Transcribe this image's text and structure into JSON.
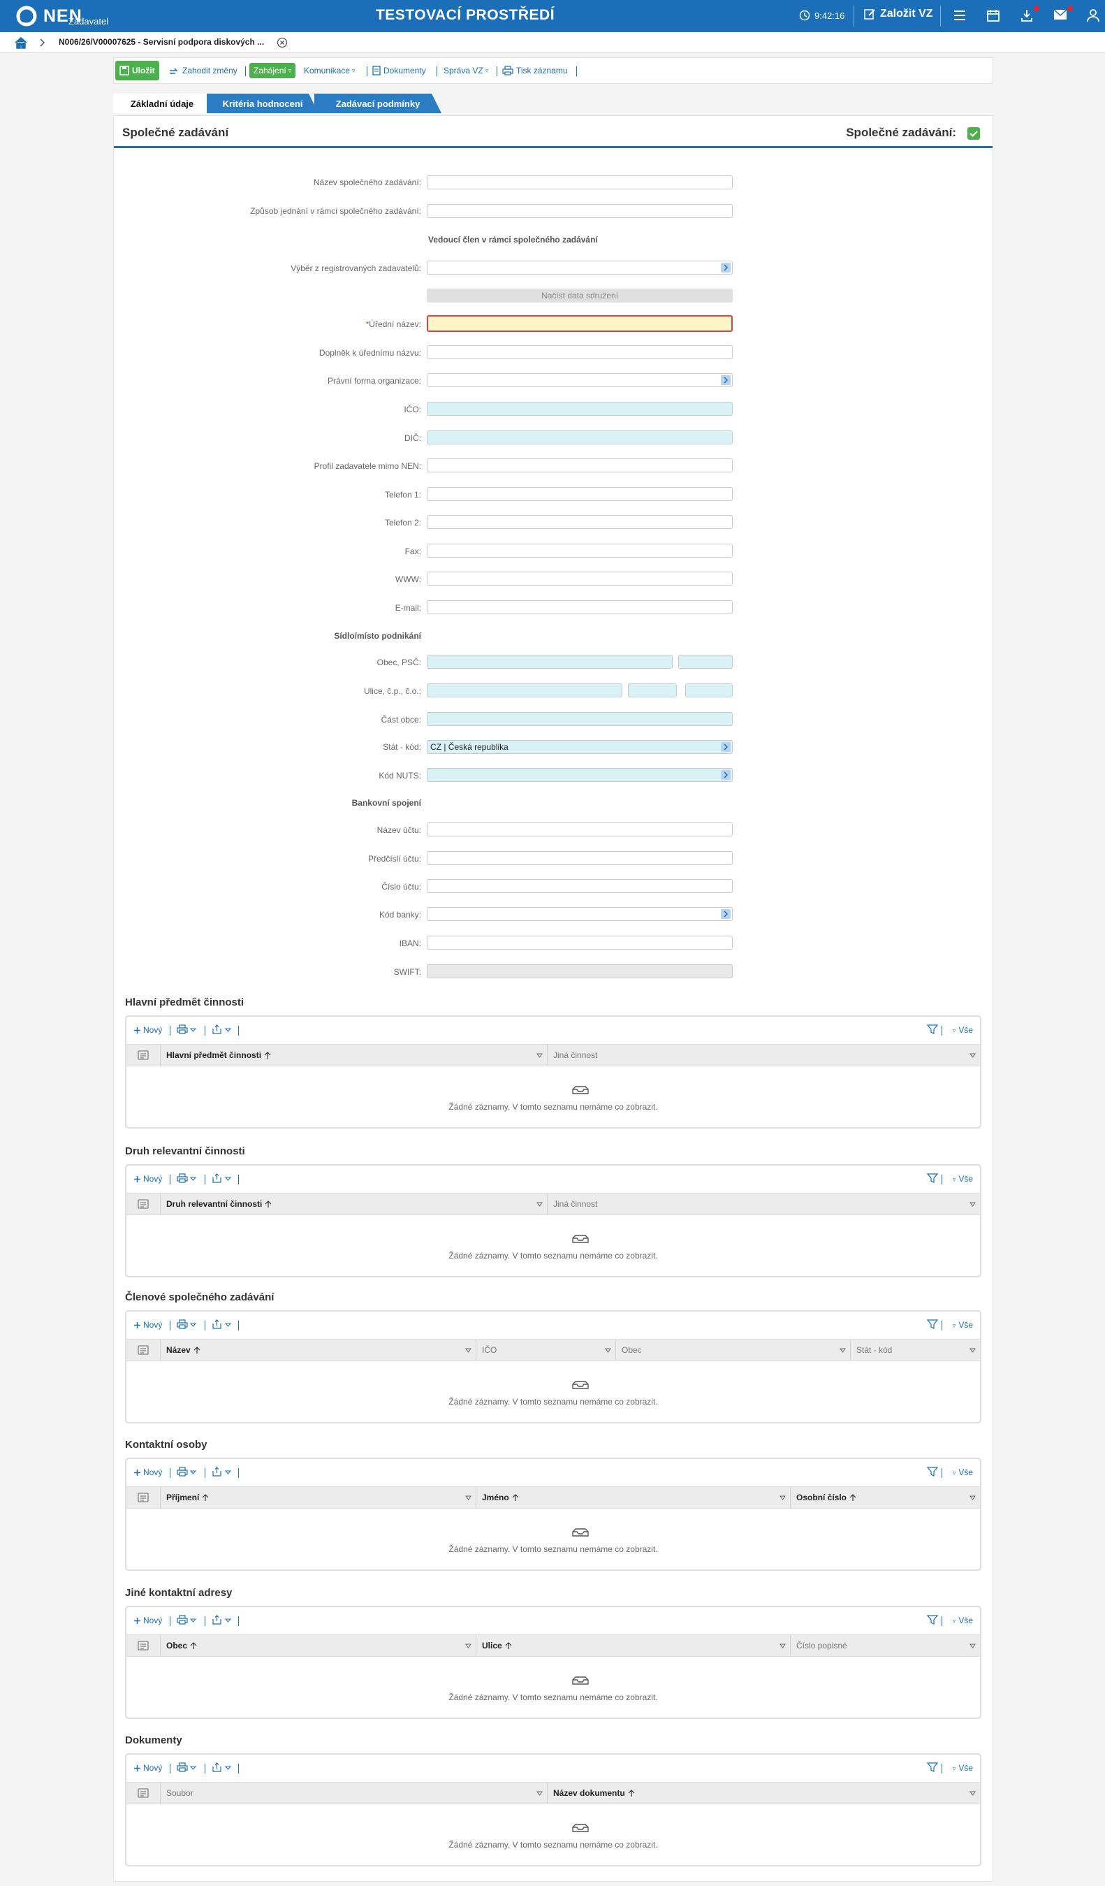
{
  "header": {
    "logo": "NEN",
    "logo_sub": "Zadavatel",
    "env_title": "TESTOVACÍ PROSTŘEDÍ",
    "time": "9:42:16",
    "create_label": "Založit VZ"
  },
  "breadcrumb": {
    "text": "N006/26/V00007625 - Servisní podpora diskových ..."
  },
  "toolbar": {
    "save": "Uložit",
    "discard": "Zahodit změny",
    "start": "Zahájení",
    "communication": "Komunikace",
    "documents": "Dokumenty",
    "manage": "Správa VZ",
    "print": "Tisk záznamu"
  },
  "tabs": [
    "Základní údaje",
    "Kritéria hodnocení",
    "Zadávací podmínky"
  ],
  "section": {
    "title": "Společné zadávání",
    "right_label": "Společné zadávání:"
  },
  "form": {
    "joint_name": "Název společného zadávání:",
    "joint_method": "Způsob jednání v rámci společného zadávání:",
    "leader_head": "Vedoucí člen v rámci společného zadávání",
    "select_registered": "Výběr z registrovaných zadavatelů:",
    "load_btn": "Načíst data sdružení",
    "official_name": "Úřední název:",
    "name_supplement": "Doplněk k úřednímu názvu:",
    "legal_form": "Právní forma organizace:",
    "ico": "IČO:",
    "dic": "DIČ:",
    "profile": "Profil zadavatele mimo NEN:",
    "phone1": "Telefon 1:",
    "phone2": "Telefon 2:",
    "fax": "Fax:",
    "www": "WWW:",
    "email": "E-mail:",
    "seat_head": "Sídlo/místo podnikání",
    "city_zip": "Obec, PSČ:",
    "street": "Ulice, č.p., č.o.:",
    "city_part": "Část obce:",
    "state_code": "Stát - kód:",
    "state_value": "CZ | Česká republika",
    "nuts": "Kód NUTS:",
    "bank_head": "Bankovní spojení",
    "account_name": "Název účtu:",
    "prefix": "Předčíslí účtu:",
    "account_no": "Číslo účtu:",
    "bank_code": "Kód banky:",
    "iban": "IBAN:",
    "swift": "SWIFT:"
  },
  "grid_common": {
    "new": "Nový",
    "all": "Vše",
    "empty": "Žádné záznamy. V tomto seznamu nemáme co zobrazit."
  },
  "grids": [
    {
      "title": "Hlavní předmět činnosti",
      "cols": [
        "Hlavní předmět činnosti",
        "Jiná činnost"
      ]
    },
    {
      "title": "Druh relevantní činnosti",
      "cols": [
        "Druh relevantní činnosti",
        "Jiná činnost"
      ]
    },
    {
      "title": "Členové společného zadávání",
      "cols": [
        "Název",
        "IČO",
        "Obec",
        "Stát - kód"
      ]
    },
    {
      "title": "Kontaktní osoby",
      "cols": [
        "Příjmení",
        "Jméno",
        "Osobní číslo"
      ]
    },
    {
      "title": "Jiné kontaktní adresy",
      "cols": [
        "Obec",
        "Ulice",
        "Číslo popisné"
      ]
    },
    {
      "title": "Dokumenty",
      "cols": [
        "Soubor",
        "Název dokumentu"
      ]
    }
  ],
  "colors": {
    "brand_blue": "#1b6fb8",
    "green": "#4cb04d",
    "required_bg": "#fff6c6",
    "readonly_cyan": "#d9f2f6"
  }
}
